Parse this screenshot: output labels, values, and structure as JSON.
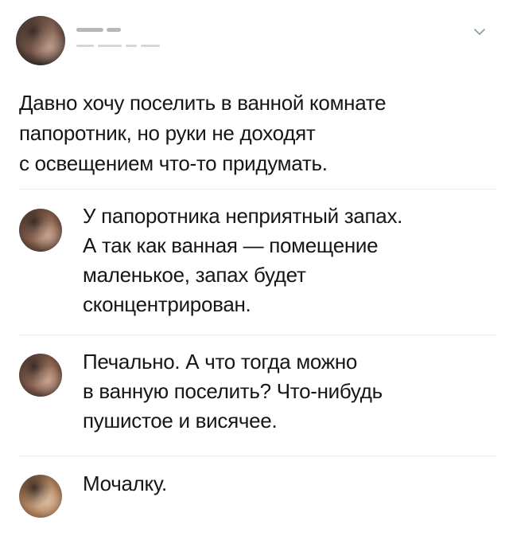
{
  "post": {
    "text": "Давно хочу поселить в ванной комнате\nпапоротник, но руки не доходят\nс освещением что-то придумать.",
    "menu_icon": "chevron-down-icon"
  },
  "replies": [
    {
      "text": "У папоротника неприятный запах.\nА так как ванная — помещение\nмаленькое, запах будет\nсконцентрирован."
    },
    {
      "text": "Печально. А что тогда можно\nв ванную поселить? Что-нибудь\nпушистое и висячее."
    },
    {
      "text": "Мочалку."
    }
  ],
  "colors": {
    "text": "#14171a",
    "divider": "#e6ecf0",
    "muted": "#8899a6"
  }
}
